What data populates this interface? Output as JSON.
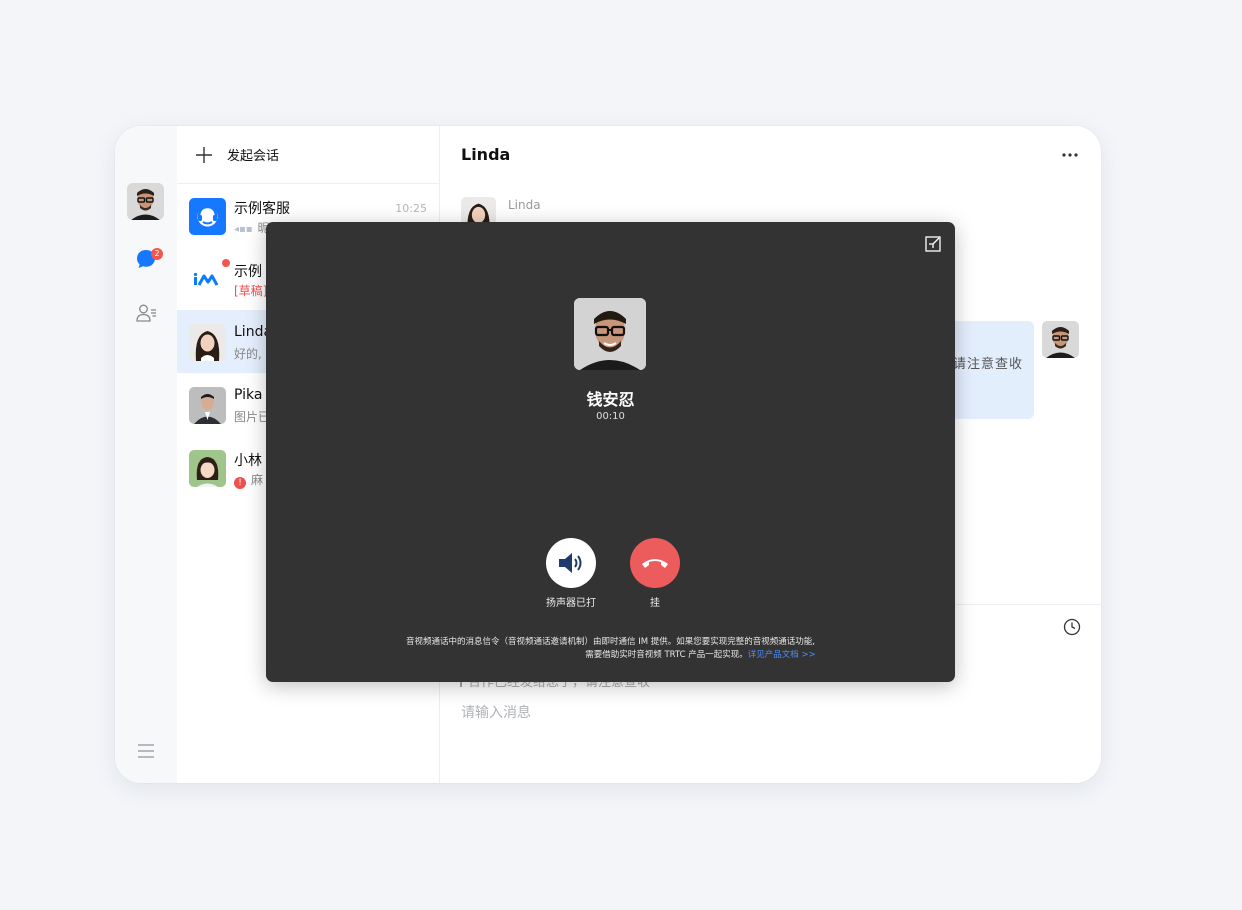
{
  "sidebar": {
    "chat_badge": "2"
  },
  "conversation_list": {
    "new_chat_label": "发起会话",
    "items": [
      {
        "name": "示例客服",
        "preview": "昵",
        "time": "10:25",
        "avatar": "headset-logo"
      },
      {
        "name": "示例",
        "preview": "[草稿]",
        "avatar": "im-logo",
        "unread_dot": true
      },
      {
        "name": "Linda",
        "preview": "好的,",
        "avatar": "woman-photo",
        "active": true
      },
      {
        "name": "Pika",
        "preview": "图片已",
        "avatar": "man-suit-photo"
      },
      {
        "name": "小林",
        "preview": "麻",
        "avatar": "girl-photo",
        "error": true
      }
    ]
  },
  "chat": {
    "title": "Linda",
    "messages": [
      {
        "sender": "Linda",
        "avatar": "woman-photo"
      },
      {
        "sender": "self",
        "text_visible": "请注意查收",
        "avatar": "man-glasses-photo"
      }
    ],
    "composer": {
      "quote_text": "合作已经发给您了，请注意查收",
      "placeholder": "请输入消息"
    }
  },
  "call": {
    "callee_name": "钱安忍",
    "duration": "00:10",
    "speaker_label": "扬声器已打",
    "hangup_label": "挂",
    "notice_line1": "音视频通话中的消息信令（音视频通话邀请机制）由即时通信 IM 提供。如果您要实现完整的音视频通话功能,",
    "notice_line2": "需要借助实时音视频 TRTC 产品一起实现。",
    "notice_link": "详见产品文档 >>"
  },
  "colors": {
    "accent": "#1677ff",
    "badge": "#f3564d",
    "hangup": "#ec5c5c",
    "call_bg": "#333333",
    "active_item": "#e4eefc"
  }
}
